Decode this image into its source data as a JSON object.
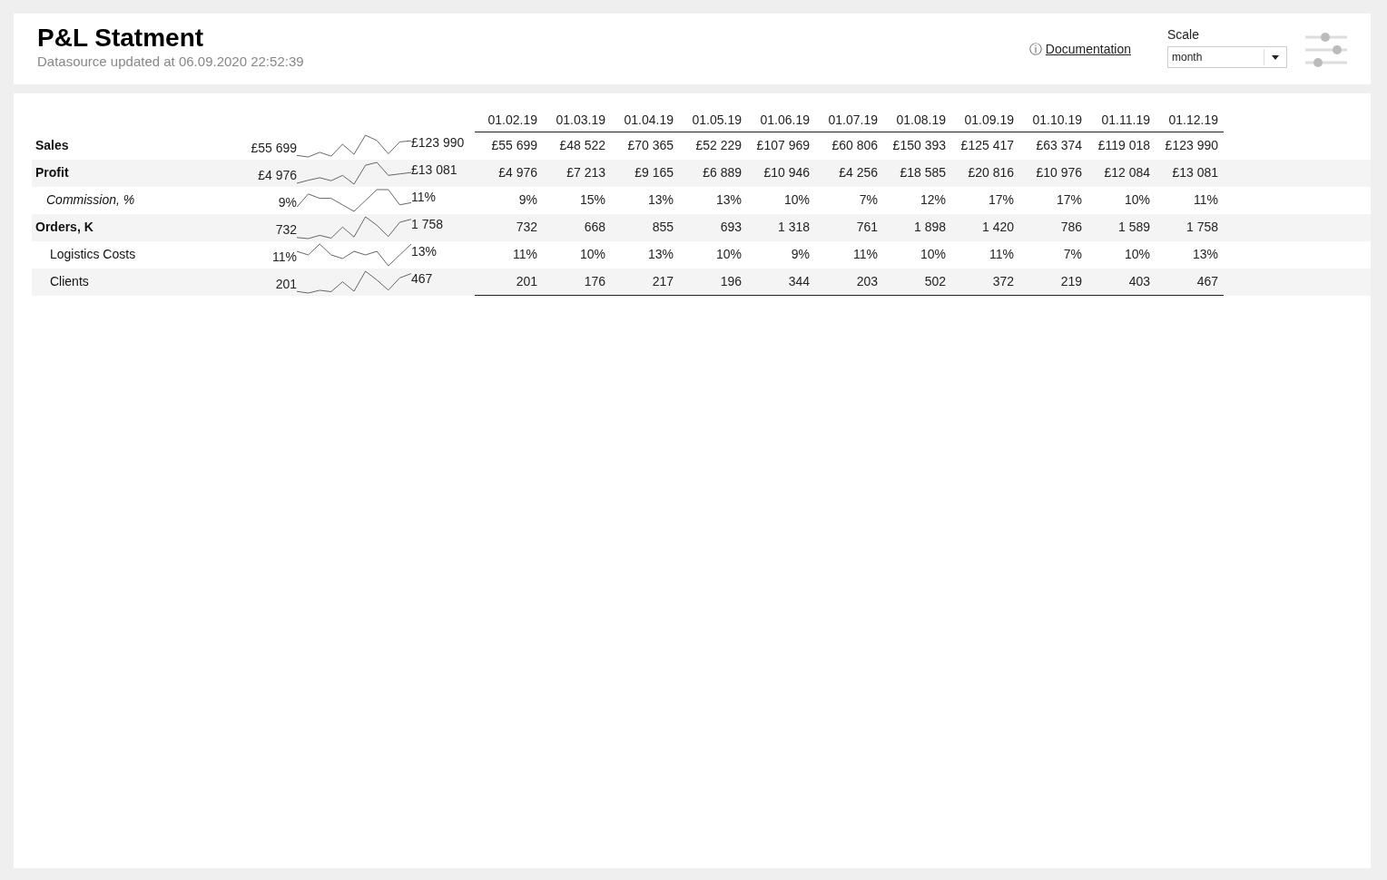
{
  "header": {
    "title": "P&L Statment",
    "subtitle": "Datasource updated at 06.09.2020 22:52:39",
    "info_icon": "ⓘ",
    "documentation_link": "Documentation",
    "scale": {
      "label": "Scale",
      "value": "month"
    }
  },
  "table": {
    "columns": [
      "01.02.19",
      "01.03.19",
      "01.04.19",
      "01.05.19",
      "01.06.19",
      "01.07.19",
      "01.08.19",
      "01.09.19",
      "01.10.19",
      "01.11.19",
      "01.12.19"
    ],
    "rows": [
      {
        "label": "Sales",
        "kind": "main",
        "spark_start": "£55 699",
        "spark_end": "£123 990",
        "values": [
          "£55 699",
          "£48 522",
          "£70 365",
          "£52 229",
          "£107 969",
          "£60 806",
          "£150 393",
          "£125 417",
          "£63 374",
          "£119 018",
          "£123 990"
        ]
      },
      {
        "label": "Profit",
        "kind": "main",
        "spark_start": "£4 976",
        "spark_end": "£13 081",
        "values": [
          "£4 976",
          "£7 213",
          "£9 165",
          "£6 889",
          "£10 946",
          "£4 256",
          "£18 585",
          "£20 816",
          "£10 976",
          "£12 084",
          "£13 081"
        ]
      },
      {
        "label": "Commission, %",
        "kind": "ratio",
        "spark_start": "9%",
        "spark_end": "11%",
        "values": [
          "9%",
          "15%",
          "13%",
          "13%",
          "10%",
          "7%",
          "12%",
          "17%",
          "17%",
          "10%",
          "11%"
        ]
      },
      {
        "label": "Orders, K",
        "kind": "main",
        "spark_start": "732",
        "spark_end": "1 758",
        "values": [
          "732",
          "668",
          "855",
          "693",
          "1 318",
          "761",
          "1 898",
          "1 420",
          "786",
          "1 589",
          "1 758"
        ]
      },
      {
        "label": "Logistics Costs",
        "kind": "sub",
        "spark_start": "11%",
        "spark_end": "13%",
        "values": [
          "11%",
          "10%",
          "13%",
          "10%",
          "9%",
          "11%",
          "10%",
          "11%",
          "7%",
          "10%",
          "13%"
        ]
      },
      {
        "label": "Clients",
        "kind": "sub",
        "spark_start": "201",
        "spark_end": "467",
        "values": [
          "201",
          "176",
          "217",
          "196",
          "344",
          "203",
          "502",
          "372",
          "219",
          "403",
          "467"
        ]
      }
    ]
  }
}
